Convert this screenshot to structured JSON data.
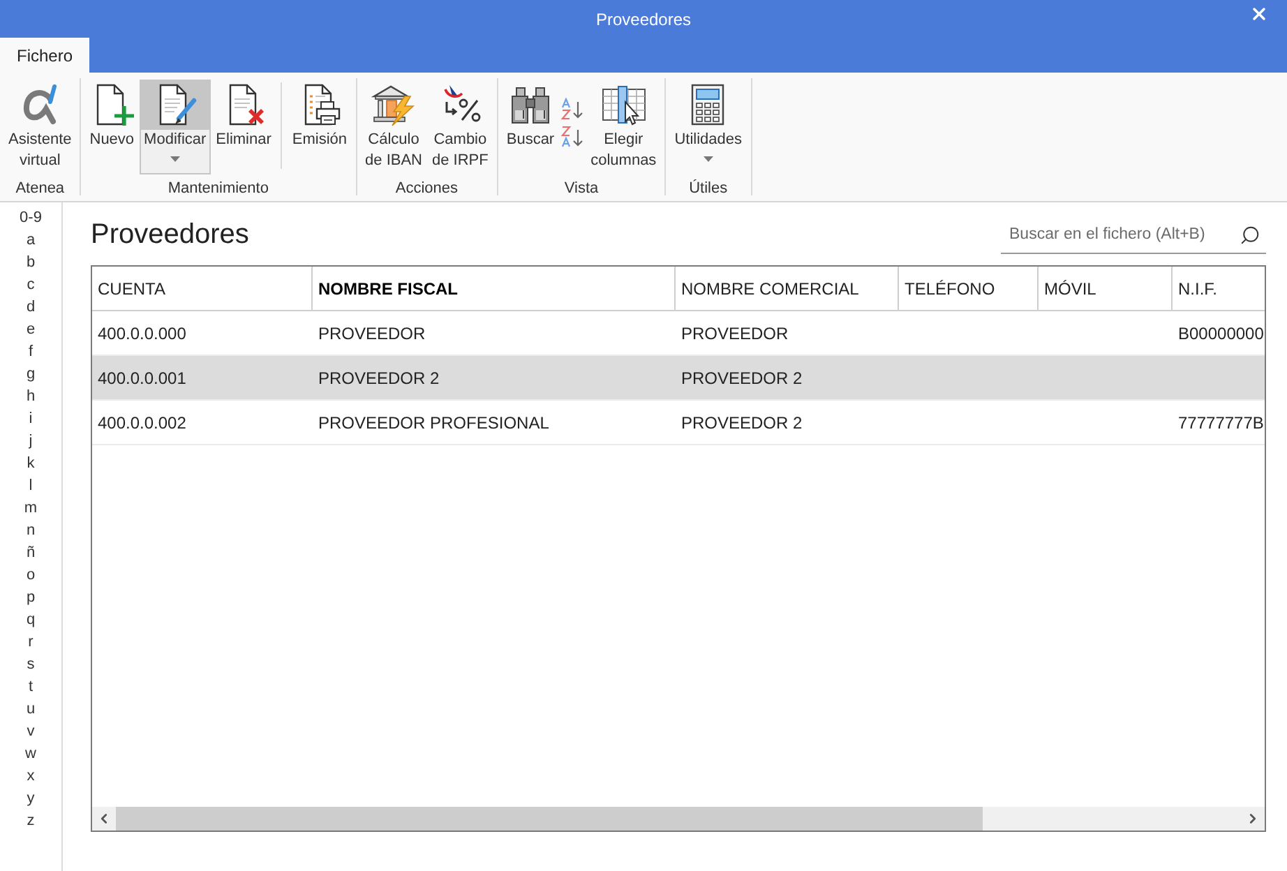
{
  "window": {
    "title": "Proveedores"
  },
  "ribbon_tabs": [
    {
      "label": "Fichero",
      "selected": true
    }
  ],
  "ribbon_groups": [
    {
      "label": "Atenea",
      "items": [
        {
          "kind": "button",
          "label": "Asistente\nvirtual",
          "hovered": false,
          "dropdown": false
        }
      ]
    },
    {
      "label": "Mantenimiento",
      "items": [
        {
          "kind": "button",
          "label": "Nuevo",
          "hovered": false,
          "dropdown": false
        },
        {
          "kind": "button",
          "label": "Modificar",
          "hovered": true,
          "dropdown": true
        },
        {
          "kind": "button",
          "label": "Eliminar",
          "hovered": false,
          "dropdown": false
        },
        {
          "kind": "separator"
        },
        {
          "kind": "button",
          "label": "Emisión",
          "hovered": false,
          "dropdown": false
        }
      ]
    },
    {
      "label": "Acciones",
      "items": [
        {
          "kind": "button",
          "label": "Cálculo\nde IBAN",
          "hovered": false,
          "dropdown": false
        },
        {
          "kind": "button",
          "label": "Cambio\nde IRPF",
          "hovered": false,
          "dropdown": false
        }
      ]
    },
    {
      "label": "Vista",
      "items": [
        {
          "kind": "button",
          "label": "Buscar",
          "hovered": false,
          "dropdown": false
        },
        {
          "kind": "sort_buttons"
        },
        {
          "kind": "button",
          "label": "Elegir\ncolumnas",
          "hovered": false,
          "dropdown": false
        }
      ]
    },
    {
      "label": "Útiles",
      "items": [
        {
          "kind": "button",
          "label": "Utilidades",
          "hovered": false,
          "dropdown": true
        }
      ]
    }
  ],
  "index_letters": [
    "0-9",
    "a",
    "b",
    "c",
    "d",
    "e",
    "f",
    "g",
    "h",
    "i",
    "j",
    "k",
    "l",
    "m",
    "n",
    "ñ",
    "o",
    "p",
    "q",
    "r",
    "s",
    "t",
    "u",
    "v",
    "w",
    "x",
    "y",
    "z"
  ],
  "page_title": "Proveedores",
  "search": {
    "placeholder": "Buscar en el fichero (Alt+B)"
  },
  "table": {
    "columns": [
      {
        "label": "CUENTA",
        "sorted": false
      },
      {
        "label": "NOMBRE FISCAL",
        "sorted": true
      },
      {
        "label": "NOMBRE COMERCIAL",
        "sorted": false
      },
      {
        "label": "TELÉFONO",
        "sorted": false
      },
      {
        "label": "MÓVIL",
        "sorted": false
      },
      {
        "label": "N.I.F.",
        "sorted": false
      }
    ],
    "rows": [
      {
        "selected": false,
        "cells": [
          "400.0.0.000",
          "PROVEEDOR",
          "PROVEEDOR",
          null,
          null,
          "B00000000"
        ]
      },
      {
        "selected": true,
        "cells": [
          "400.0.0.001",
          "PROVEEDOR 2",
          "PROVEEDOR 2",
          null,
          null,
          null
        ]
      },
      {
        "selected": false,
        "cells": [
          "400.0.0.002",
          "PROVEEDOR PROFESIONAL",
          "PROVEEDOR 2",
          null,
          null,
          "77777777B"
        ]
      }
    ]
  }
}
